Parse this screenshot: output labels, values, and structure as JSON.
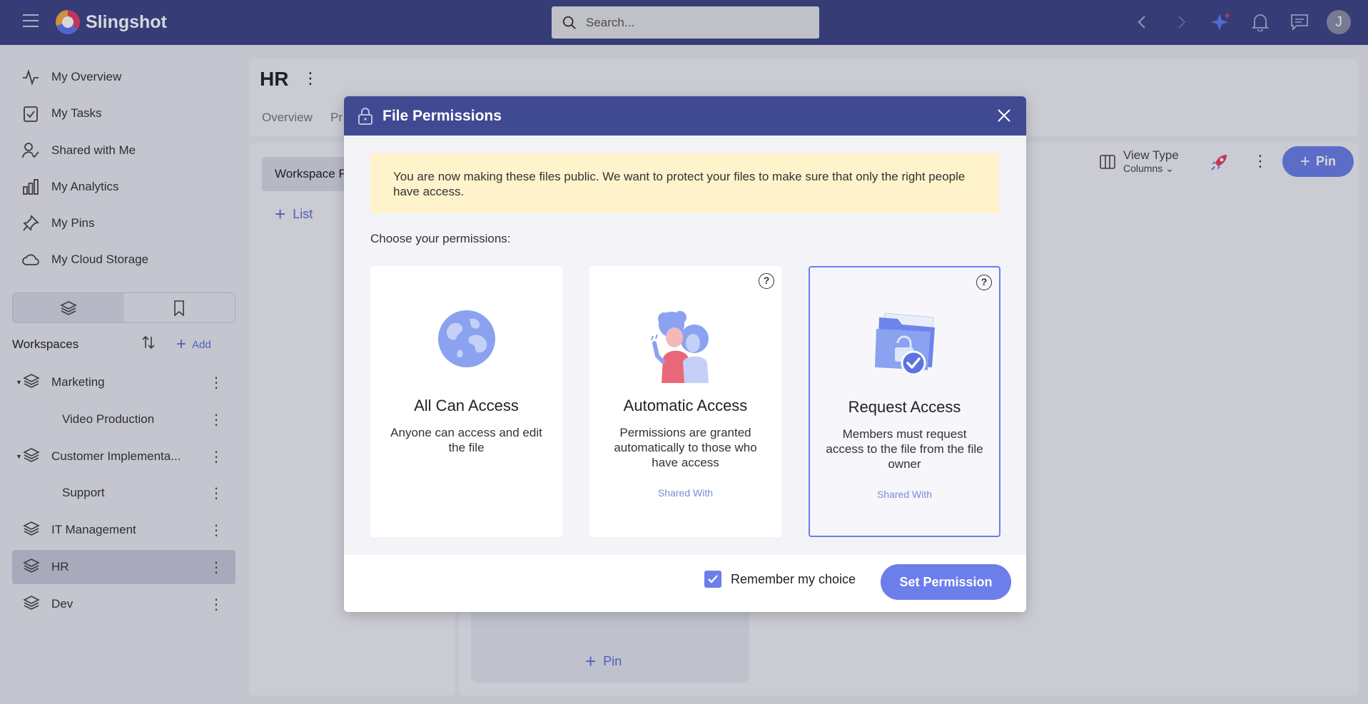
{
  "app": {
    "name": "Slingshot"
  },
  "search": {
    "placeholder": "Search..."
  },
  "user": {
    "initial": "J"
  },
  "nav": {
    "items": [
      {
        "label": "My Overview",
        "icon": "activity-icon"
      },
      {
        "label": "My Tasks",
        "icon": "task-check-icon"
      },
      {
        "label": "Shared with Me",
        "icon": "user-check-icon"
      },
      {
        "label": "My Analytics",
        "icon": "bar-chart-icon"
      },
      {
        "label": "My Pins",
        "icon": "pin-icon"
      },
      {
        "label": "My Cloud Storage",
        "icon": "cloud-icon"
      }
    ]
  },
  "workspaces": {
    "title": "Workspaces",
    "add_label": "Add",
    "items": [
      {
        "label": "Marketing",
        "expanded": true
      },
      {
        "label": "Video Production",
        "child": true
      },
      {
        "label": "Customer Implementa...",
        "expanded": true
      },
      {
        "label": "Support",
        "child": true
      },
      {
        "label": "IT Management"
      },
      {
        "label": "HR",
        "active": true
      },
      {
        "label": "Dev"
      }
    ]
  },
  "main": {
    "title": "HR",
    "tabs": [
      "Overview",
      "Pr"
    ],
    "left_pill": "Workspace F",
    "list_add": "List",
    "view_type_label": "View Type",
    "view_type_value": "Columns",
    "pin_button": "Pin",
    "pin_link": "Pin"
  },
  "modal": {
    "title": "File Permissions",
    "notice": "You are now making these files public. We want to protect your files to make sure that only the right people have access.",
    "choose_label": "Choose your permissions:",
    "options": [
      {
        "title": "All Can Access",
        "description": "Anyone can access and edit the file",
        "shared": "",
        "selected": false,
        "help": false
      },
      {
        "title": "Automatic Access",
        "description": "Permissions are granted automatically to those who have access",
        "shared": "Shared With",
        "selected": false,
        "help": true
      },
      {
        "title": "Request Access",
        "description": "Members must request access to the file from the file owner",
        "shared": "Shared With",
        "selected": true,
        "help": true
      }
    ],
    "remember_label": "Remember my choice",
    "remember_checked": true,
    "submit_label": "Set Permission"
  },
  "colors": {
    "topbar": "#3b4285",
    "modal_header": "#3f4a93",
    "accent": "#6b7eea",
    "notice_bg": "#fff3cc"
  }
}
